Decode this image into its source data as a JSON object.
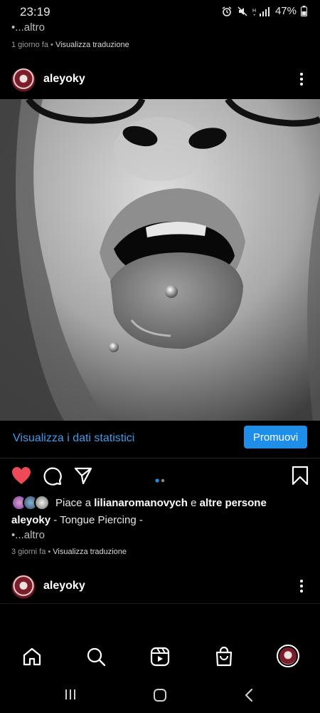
{
  "status_bar": {
    "time": "23:19",
    "battery": "47%"
  },
  "top_post": {
    "more": "•...altro",
    "time": "1 giorno fa",
    "separator": " • ",
    "translate": "Visualizza traduzione"
  },
  "post": {
    "username": "aleyoky",
    "photo_desc": "black-and-white close-up of open mouth with tongue piercing",
    "stats_link": "Visualizza i dati statistici",
    "promote": "Promuovi",
    "likes_prefix": "Piace a ",
    "likes_user": "lilianaromanovych",
    "likes_and": " e ",
    "likes_others": "altre persone",
    "caption_user": "aleyoky",
    "caption_text": " - Tongue Piercing -",
    "more": "•...altro",
    "time": "3 giorni fa",
    "separator": " • ",
    "translate": "Visualizza traduzione"
  },
  "next_post": {
    "username": "aleyoky"
  },
  "colors": {
    "like": "#ed4956",
    "link": "#3d9bea",
    "promote_bg": "#1e8ee8",
    "carousel_active": "#1e8ee8"
  },
  "icons": [
    "heart-icon",
    "comment-icon",
    "share-icon",
    "bookmark-icon",
    "home-icon",
    "search-icon",
    "reels-icon",
    "shop-icon",
    "profile-avatar"
  ]
}
